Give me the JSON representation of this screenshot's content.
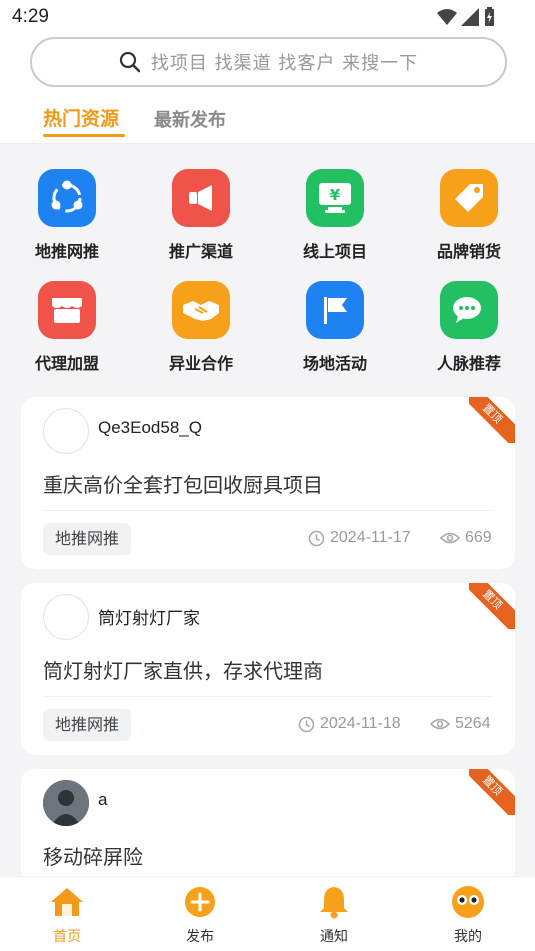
{
  "status_bar": {
    "time": "4:29"
  },
  "search": {
    "placeholder": "找项目 找渠道 找客户 来搜一下"
  },
  "tabs": [
    {
      "label": "热门资源"
    },
    {
      "label": "最新发布"
    }
  ],
  "categories": [
    {
      "label": "地推网推",
      "icon": "share-network-icon",
      "color": "#1e82f0"
    },
    {
      "label": "推广渠道",
      "icon": "megaphone-icon",
      "color": "#f0534a"
    },
    {
      "label": "线上项目",
      "icon": "monitor-yen-icon",
      "color": "#22c063"
    },
    {
      "label": "品牌销货",
      "icon": "price-tag-icon",
      "color": "#f7a11a"
    },
    {
      "label": "代理加盟",
      "icon": "storefront-icon",
      "color": "#f0534a"
    },
    {
      "label": "异业合作",
      "icon": "handshake-icon",
      "color": "#f7a11a"
    },
    {
      "label": "场地活动",
      "icon": "flag-icon",
      "color": "#1e82f0"
    },
    {
      "label": "人脉推荐",
      "icon": "chat-bubbles-icon",
      "color": "#22c063"
    }
  ],
  "posts": [
    {
      "username": "Qe3Eod58_Q",
      "title": "重庆高价全套打包回收厨具项目",
      "tag": "地推网推",
      "date": "2024-11-17",
      "views": "669",
      "badge": "置顶"
    },
    {
      "username": "筒灯射灯厂家",
      "title": "筒灯射灯厂家直供，存求代理商",
      "tag": "地推网推",
      "date": "2024-11-18",
      "views": "5264",
      "badge": "置顶"
    },
    {
      "username": "a",
      "title": "移动碎屏险",
      "badge": "置顶"
    }
  ],
  "nav": [
    {
      "label": "首页",
      "icon": "home-icon"
    },
    {
      "label": "发布",
      "icon": "plus-circle-icon"
    },
    {
      "label": "通知",
      "icon": "bell-icon"
    },
    {
      "label": "我的",
      "icon": "profile-face-icon"
    }
  ],
  "colors": {
    "accent": "#f39a1b",
    "badge": "#e5621f"
  }
}
